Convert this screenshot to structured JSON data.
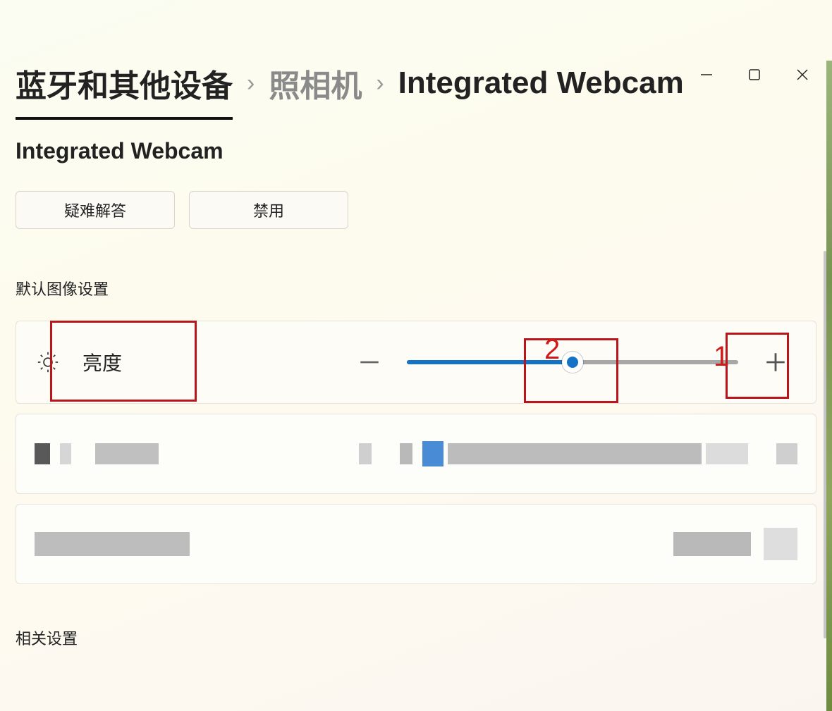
{
  "breadcrumb": {
    "items": [
      {
        "label": "蓝牙和其他设备"
      },
      {
        "label": "照相机"
      },
      {
        "label": "Integrated Webcam"
      }
    ]
  },
  "page": {
    "title": "Integrated Webcam"
  },
  "buttons": {
    "troubleshoot": "疑难解答",
    "disable": "禁用"
  },
  "sections": {
    "default_image": "默认图像设置",
    "related": "相关设置"
  },
  "settings": {
    "brightness": {
      "label": "亮度",
      "value_percent": 50
    }
  },
  "annotations": {
    "one": "1",
    "two": "2"
  }
}
